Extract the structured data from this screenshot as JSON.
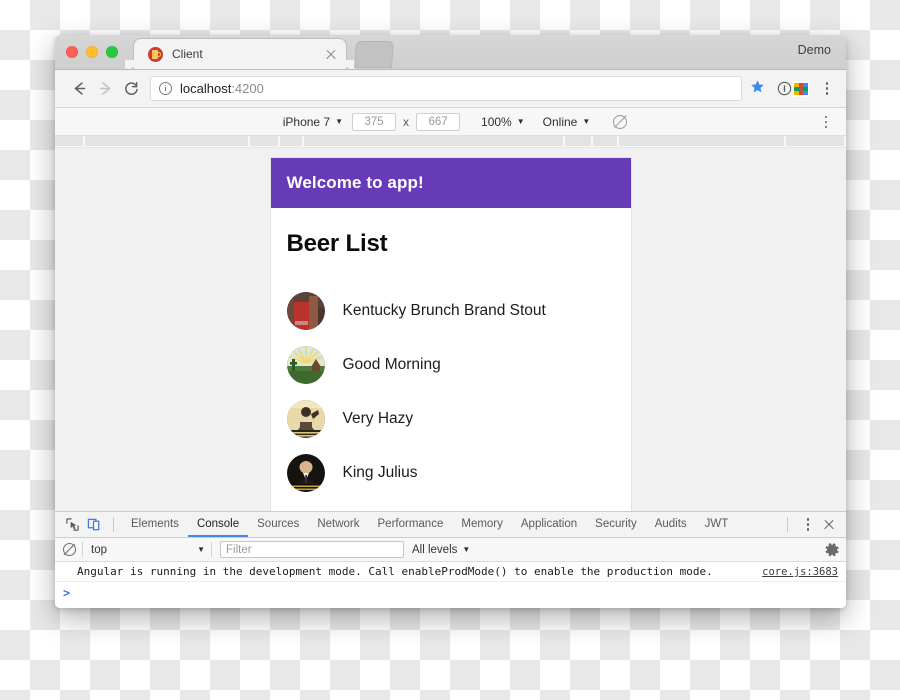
{
  "browser": {
    "window_controls": [
      "close",
      "minimize",
      "zoom"
    ],
    "profile_label": "Demo",
    "tab": {
      "title": "Client",
      "favicon": "beer-mug-icon",
      "close_label": "×"
    },
    "new_tab_label": "+",
    "nav": {
      "back": "←",
      "forward": "→",
      "reload": "⟳"
    },
    "omnibox": {
      "security_icon": "info-circle-icon",
      "url_host": "localhost",
      "url_rest": ":4200",
      "bookmark_icon": "star-icon",
      "extension_icon": "extension-icon",
      "menu_icon": "kebab-menu-icon"
    }
  },
  "device_toolbar": {
    "device": "iPhone 7",
    "width": "375",
    "height": "667",
    "dimension_separator": "x",
    "zoom": "100%",
    "throttling": "Online",
    "rotate_icon": "rotate-device-icon",
    "menu_icon": "kebab-menu-icon"
  },
  "app": {
    "header_title": "Welcome to app!",
    "header_color": "#673ab7",
    "list_title": "Beer List",
    "beers": [
      {
        "name": "Kentucky Brunch Brand Stout",
        "avatar": "beer-label-photo-1"
      },
      {
        "name": "Good Morning",
        "avatar": "beer-label-photo-2"
      },
      {
        "name": "Very Hazy",
        "avatar": "beer-label-photo-3"
      },
      {
        "name": "King Julius",
        "avatar": "beer-label-photo-4"
      }
    ]
  },
  "devtools": {
    "inspect_icon": "inspect-element-icon",
    "device_toggle_icon": "toggle-device-toolbar-icon",
    "tabs": [
      {
        "label": "Elements",
        "active": false
      },
      {
        "label": "Console",
        "active": true
      },
      {
        "label": "Sources",
        "active": false
      },
      {
        "label": "Network",
        "active": false
      },
      {
        "label": "Performance",
        "active": false
      },
      {
        "label": "Memory",
        "active": false
      },
      {
        "label": "Application",
        "active": false
      },
      {
        "label": "Security",
        "active": false
      },
      {
        "label": "Audits",
        "active": false
      },
      {
        "label": "JWT",
        "active": false
      }
    ],
    "more_icon": "kebab-menu-icon",
    "close_icon": "close-icon",
    "console_toolbar": {
      "clear_icon": "clear-console-icon",
      "context": "top",
      "filter_placeholder": "Filter",
      "filter_value": "",
      "levels": "All levels",
      "settings_icon": "gear-icon"
    },
    "console_messages": [
      {
        "text": "Angular is running in the development mode. Call enableProdMode() to enable the production mode.",
        "source": "core.js:3683"
      }
    ],
    "prompt_symbol": ">"
  }
}
